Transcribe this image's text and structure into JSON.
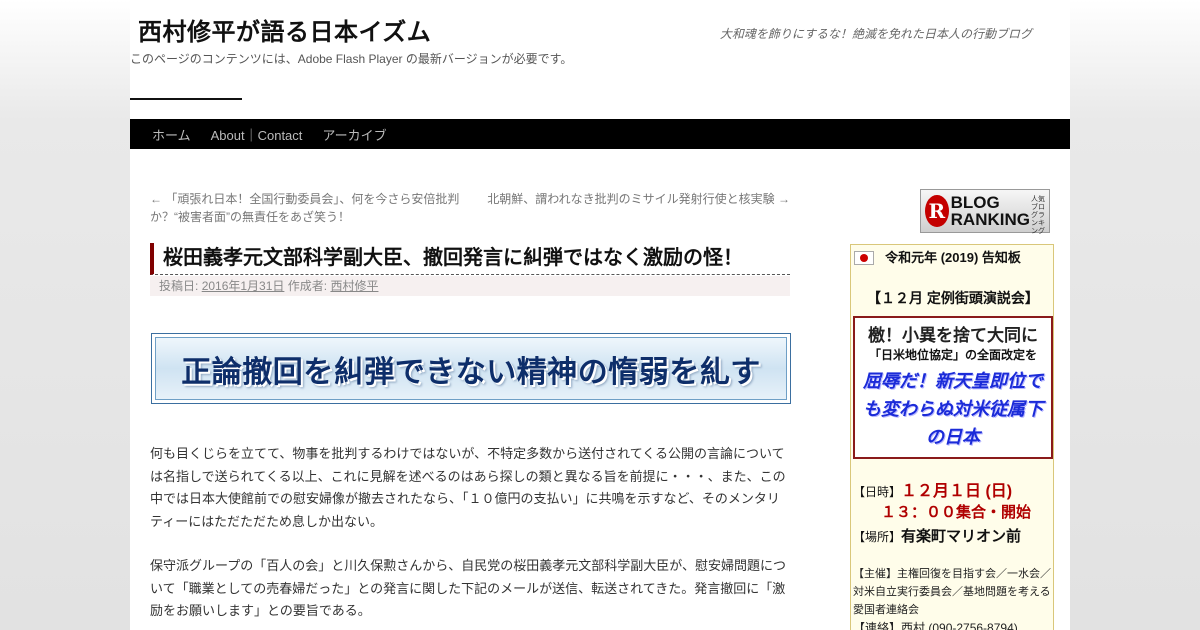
{
  "header": {
    "site_title": "西村修平が語る日本イズム",
    "site_description": "大和魂を飾りにするな！絶滅を免れた日本人の行動ブログ",
    "flash_note": "このページのコンテンツには、Adobe Flash Player の最新バージョンが必要です。"
  },
  "nav": {
    "items": [
      {
        "label": "ホーム"
      },
      {
        "label": "About｜Contact"
      },
      {
        "label": "アーカイブ"
      }
    ]
  },
  "post_nav": {
    "prev": "← 「頑張れ日本！全国行動委員会」、何を今さら安倍批判か？“被害者面”の無責任をあざ笑う！",
    "next": "北朝鮮、謂われなき批判のミサイル発射行使と核実験 →"
  },
  "post": {
    "title": "桜田義孝元文部科学副大臣、撤回発言に糾弾ではなく激励の怪！",
    "meta_posted_label": "投稿日:",
    "meta_date": "2016年1月31日",
    "meta_author_label": "作成者:",
    "meta_author": "西村修平",
    "banner_text": "正論撤回を糾弾できない精神の惰弱を糺す",
    "paragraphs": [
      "何も目くじらを立てて、物事を批判するわけではないが、不特定多数から送付されてくる公開の言論については名指しで送られてくる以上、これに見解を述べるのはあら探しの類と異なる旨を前提に・・・、また、この中では日本大使館前での慰安婦像が撤去されたなら、「１０億円の支払い」に共鳴を示すなど、そのメンタリティーにはただただため息しか出ない。",
      "保守派グループの「百人の会」と川久保勲さんから、自民党の桜田義孝元文部科学副大臣が、慰安婦問題について「職業としての売春婦だった」との発言に関した下記のメールが送信、転送されてきた。発言撤回に「激励をお願いします」との要旨である。"
    ]
  },
  "sidebar": {
    "ranking_word": "BLOG RANKING",
    "ranking_small": "人気ブログランキング",
    "notice_title": "令和元年 (2019) 告知板",
    "event_name": "【１２月 定例街頭演説会】",
    "rb_line1": "檄！小異を捨て大同に",
    "rb_line2": "「日米地位協定」の全面改定を",
    "rb_line3": "屈辱だ！新天皇即位でも変わらぬ対米従属下の日本",
    "date_label": "【日時】",
    "date_value": "１２月１日 (日)",
    "time_value": "１３：００集合・開始",
    "place_label": "【場所】",
    "place_value": "有楽町マリオン前",
    "org_label": "【主催】",
    "org_value": "主権回復を目指す会／一水会／対米自立実行委員会／基地問題を考える愛国者連絡会",
    "contact_label": "【連絡】",
    "contact_value": "西村 (090-2756-8794)"
  }
}
